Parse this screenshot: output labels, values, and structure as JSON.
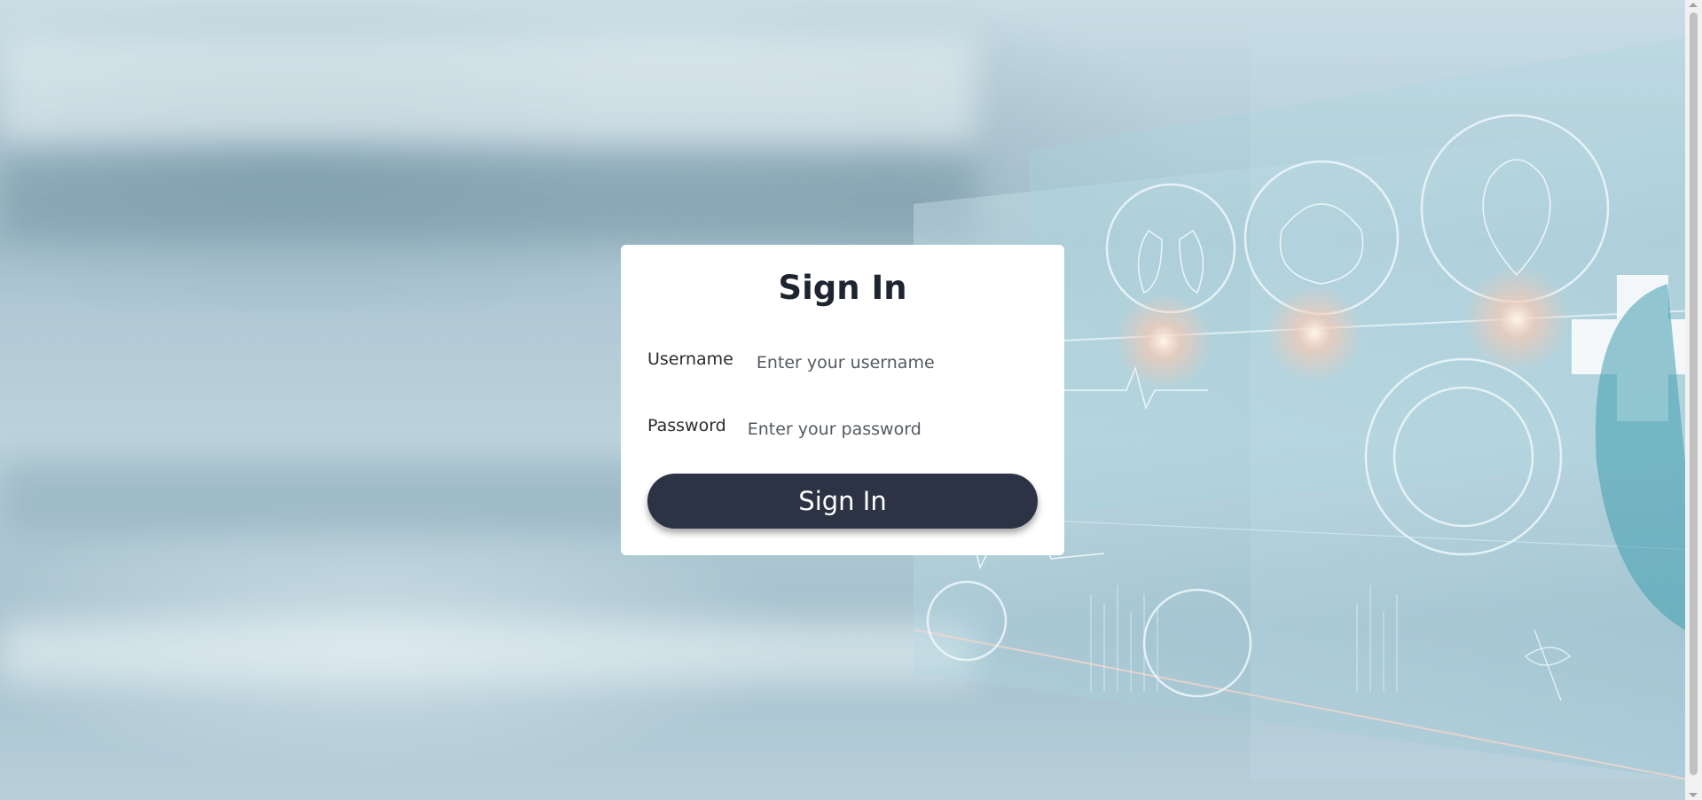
{
  "form": {
    "title": "Sign In",
    "username": {
      "label": "Username",
      "value": "",
      "placeholder": "Enter your username"
    },
    "password": {
      "label": "Password",
      "value": "",
      "placeholder": "Enter your password"
    },
    "submit_label": "Sign In"
  },
  "background": {
    "description_icons": [
      "lungs-icon",
      "brain-icon",
      "heart-icon",
      "medical-cross-icon",
      "thermometer-icon",
      "dna-icon"
    ]
  },
  "colors": {
    "card": "#ffffff",
    "button": "#2c3345",
    "button_text": "#ffffff",
    "title": "#1f2530"
  }
}
